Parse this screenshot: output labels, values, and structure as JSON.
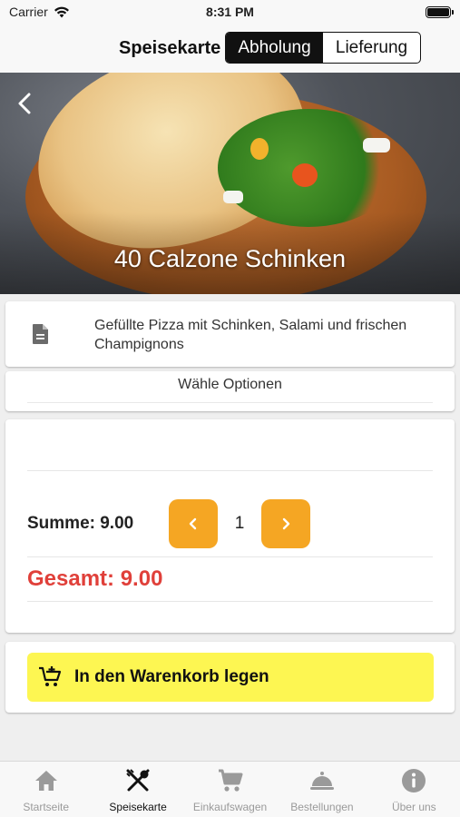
{
  "status_bar": {
    "carrier": "Carrier",
    "time": "8:31 PM"
  },
  "nav": {
    "title": "Speisekarte",
    "segments": [
      {
        "label": "Abholung",
        "selected": true
      },
      {
        "label": "Lieferung",
        "selected": false
      }
    ]
  },
  "product": {
    "name": "40 Calzone Schinken",
    "description": "Gefüllte Pizza mit Schinken, Salami und frischen Champignons",
    "options_label": "Wähle Optionen"
  },
  "order": {
    "sum_label": "Summe: 9.00",
    "quantity": "1",
    "total_label": "Gesamt: 9.00"
  },
  "cart_button": {
    "label": "In den Warenkorb legen"
  },
  "tab_bar": {
    "items": [
      {
        "label": "Startseite",
        "icon": "home-icon"
      },
      {
        "label": "Speisekarte",
        "icon": "cutlery-icon",
        "active": true
      },
      {
        "label": "Einkaufswagen",
        "icon": "cart-icon"
      },
      {
        "label": "Bestellungen",
        "icon": "cloche-icon"
      },
      {
        "label": "Über uns",
        "icon": "info-icon"
      }
    ]
  },
  "colors": {
    "accent_orange": "#f5a623",
    "total_red": "#e0403a",
    "cart_yellow": "#fdf652",
    "inactive_tab": "#9a9a9a"
  }
}
